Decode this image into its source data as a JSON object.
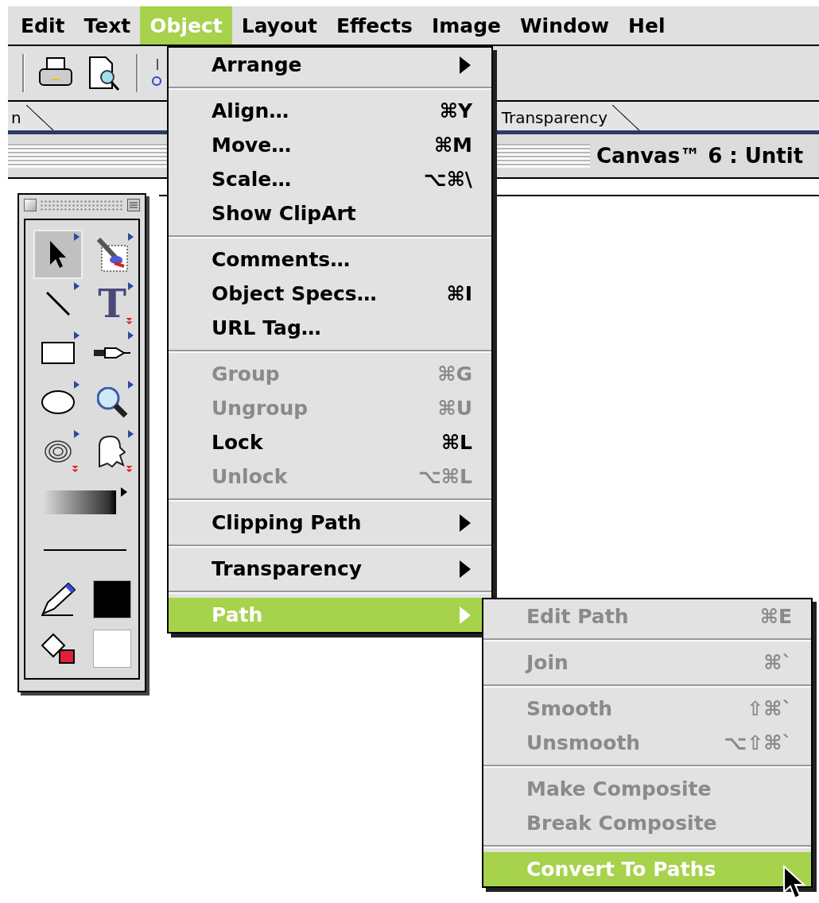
{
  "menu_bar": {
    "items": [
      {
        "label": "Edit",
        "selected": false
      },
      {
        "label": "Text",
        "selected": false
      },
      {
        "label": "Object",
        "selected": true
      },
      {
        "label": "Layout",
        "selected": false
      },
      {
        "label": "Effects",
        "selected": false
      },
      {
        "label": "Image",
        "selected": false
      },
      {
        "label": "Window",
        "selected": false
      },
      {
        "label": "Hel",
        "selected": false
      }
    ]
  },
  "tabs": [
    {
      "label": "n"
    },
    {
      "label": "Transparency"
    }
  ],
  "window": {
    "title": "Canvas™ 6 : Untit"
  },
  "tool_palette": {
    "tools": [
      {
        "kind": "arrow",
        "selected": true
      },
      {
        "kind": "brush",
        "selected": false
      },
      {
        "kind": "line",
        "selected": false
      },
      {
        "kind": "text",
        "glyph": "T",
        "selected": false
      },
      {
        "kind": "rectangle",
        "selected": false
      },
      {
        "kind": "pen",
        "selected": false
      },
      {
        "kind": "oval",
        "selected": false
      },
      {
        "kind": "magnifier",
        "selected": false
      },
      {
        "kind": "spiral",
        "selected": false
      },
      {
        "kind": "ghost",
        "selected": false
      },
      {
        "kind": "gradient",
        "selected": false
      },
      {
        "kind": "line-weight",
        "selected": false
      },
      {
        "kind": "pencil",
        "selected": false
      },
      {
        "kind": "swatch",
        "color": "#000000",
        "selected": false
      },
      {
        "kind": "bucket",
        "selected": false
      },
      {
        "kind": "swatch",
        "color": "#ffffff",
        "selected": false
      }
    ]
  },
  "object_menu": {
    "groups": [
      {
        "items": [
          {
            "label": "Arrange",
            "disabled": false,
            "selected": false,
            "submenu": true
          }
        ]
      },
      {
        "items": [
          {
            "label": "Align…",
            "shortcut": "⌘Y",
            "disabled": false,
            "selected": false,
            "submenu": false
          },
          {
            "label": "Move…",
            "shortcut": "⌘M",
            "disabled": false,
            "selected": false,
            "submenu": false
          },
          {
            "label": "Scale…",
            "shortcut": "⌥⌘\\",
            "disabled": false,
            "selected": false,
            "submenu": false
          },
          {
            "label": "Show ClipArt",
            "disabled": false,
            "selected": false,
            "submenu": false
          }
        ]
      },
      {
        "items": [
          {
            "label": "Comments…",
            "disabled": false,
            "selected": false,
            "submenu": false
          },
          {
            "label": "Object Specs…",
            "shortcut": "⌘I",
            "disabled": false,
            "selected": false,
            "submenu": false
          },
          {
            "label": "URL Tag…",
            "disabled": false,
            "selected": false,
            "submenu": false
          }
        ]
      },
      {
        "items": [
          {
            "label": "Group",
            "shortcut": "⌘G",
            "disabled": true,
            "selected": false,
            "submenu": false
          },
          {
            "label": "Ungroup",
            "shortcut": "⌘U",
            "disabled": true,
            "selected": false,
            "submenu": false
          },
          {
            "label": "Lock",
            "shortcut": "⌘L",
            "disabled": false,
            "selected": false,
            "submenu": false
          },
          {
            "label": "Unlock",
            "shortcut": "⌥⌘L",
            "disabled": true,
            "selected": false,
            "submenu": false
          }
        ]
      },
      {
        "items": [
          {
            "label": "Clipping Path",
            "disabled": false,
            "selected": false,
            "submenu": true
          }
        ]
      },
      {
        "items": [
          {
            "label": "Transparency",
            "disabled": false,
            "selected": false,
            "submenu": true
          }
        ]
      },
      {
        "items": [
          {
            "label": "Path",
            "disabled": false,
            "selected": true,
            "submenu": true
          }
        ]
      }
    ]
  },
  "path_submenu": {
    "groups": [
      {
        "items": [
          {
            "label": "Edit Path",
            "shortcut": "⌘E",
            "disabled": true,
            "selected": false,
            "submenu": false
          }
        ]
      },
      {
        "items": [
          {
            "label": "Join",
            "shortcut": "⌘`",
            "disabled": true,
            "selected": false,
            "submenu": false
          }
        ]
      },
      {
        "items": [
          {
            "label": "Smooth",
            "shortcut": "⇧⌘`",
            "disabled": true,
            "selected": false,
            "submenu": false
          },
          {
            "label": "Unsmooth",
            "shortcut": "⌥⇧⌘`",
            "disabled": true,
            "selected": false,
            "submenu": false
          }
        ]
      },
      {
        "items": [
          {
            "label": "Make Composite",
            "disabled": true,
            "selected": false,
            "submenu": false
          },
          {
            "label": "Break Composite",
            "disabled": true,
            "selected": false,
            "submenu": false
          }
        ]
      },
      {
        "items": [
          {
            "label": "Convert To Paths",
            "disabled": false,
            "selected": true,
            "submenu": false
          }
        ]
      }
    ]
  }
}
